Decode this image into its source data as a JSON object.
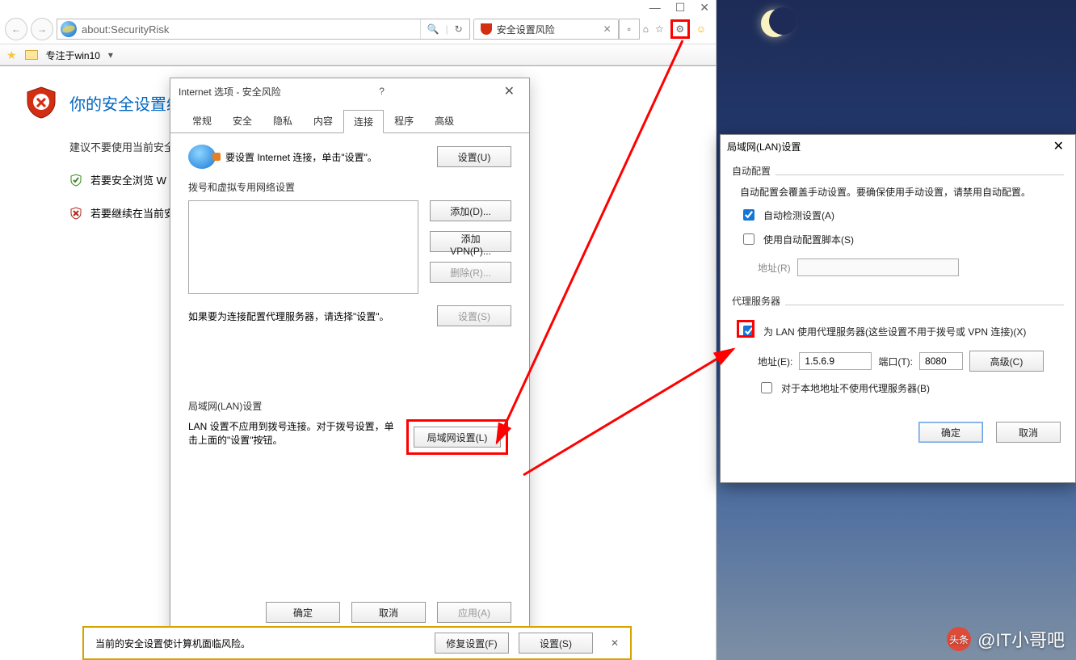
{
  "ie": {
    "address": "about:SecurityRisk",
    "tabLabel": "安全设置风险",
    "favFolder": "专注于win10",
    "pageTitle": "你的安全设置级别",
    "pageSub": "建议不要使用当前安全",
    "bullet1": "若要安全浏览 W",
    "bullet2": "若要继续在当前安全"
  },
  "inetDlg": {
    "title": "Internet 选项 - 安全风险",
    "tabs": {
      "general": "常规",
      "security": "安全",
      "privacy": "隐私",
      "content": "内容",
      "connections": "连接",
      "programs": "程序",
      "advanced": "高级"
    },
    "setupText": "要设置 Internet 连接，单击\"设置\"。",
    "setupBtn": "设置(U)",
    "dialSection": "拨号和虚拟专用网络设置",
    "addBtn": "添加(D)...",
    "addVpnBtn": "添加 VPN(P)...",
    "removeBtn": "删除(R)...",
    "proxyHint": "如果要为连接配置代理服务器，请选择\"设置\"。",
    "settingsBtn": "设置(S)",
    "lanSection": "局域网(LAN)设置",
    "lanHint": "LAN 设置不应用到拨号连接。对于拨号设置，单击上面的\"设置\"按钮。",
    "lanBtn": "局域网设置(L)",
    "ok": "确定",
    "cancel": "取消",
    "apply": "应用(A)"
  },
  "warn": {
    "text": "当前的安全设置使计算机面临风险。",
    "fixBtn": "修复设置(F)",
    "settingsBtn": "设置(S)"
  },
  "lanDlg": {
    "title": "局域网(LAN)设置",
    "autoSection": "自动配置",
    "autoText": "自动配置会覆盖手动设置。要确保使用手动设置，请禁用自动配置。",
    "autoDetect": "自动检测设置(A)",
    "autoScript": "使用自动配置脚本(S)",
    "addrLabel": "地址(R)",
    "proxySection": "代理服务器",
    "proxyCheck": "为 LAN 使用代理服务器(这些设置不用于拨号或 VPN 连接)(X)",
    "addrELabel": "地址(E):",
    "addrValue": "1.5.6.9",
    "portLabel": "端口(T):",
    "portValue": "8080",
    "advBtn": "高级(C)",
    "bypassLocal": "对于本地地址不使用代理服务器(B)",
    "ok": "确定",
    "cancel": "取消"
  },
  "watermark": {
    "brand": "头条",
    "author": "@IT小哥吧"
  }
}
